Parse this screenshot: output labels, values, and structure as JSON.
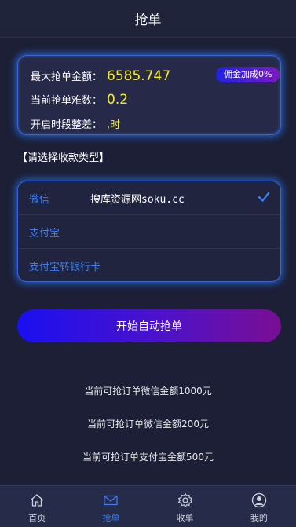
{
  "header": {
    "title": "抢单"
  },
  "stats": {
    "max_amount_label": "最大抢单金额：",
    "max_amount_value": "6585.747",
    "difficulty_label": "当前抢单难数：",
    "difficulty_value": "0.2",
    "period_label": "开启时段整差：",
    "period_value": ",时",
    "badge": "佣金加成0%"
  },
  "section_title": "【请选择收款类型】",
  "payment_options": [
    {
      "label": "微信",
      "note": "搜库资源网soku.cc",
      "selected": true
    },
    {
      "label": "支付宝"
    },
    {
      "label": "支付宝转银行卡"
    }
  ],
  "start_button": "开始自动抢单",
  "info_lines": [
    "当前可抢订单微信金额1000元",
    "当前可抢订单微信金额200元",
    "当前可抢订单支付宝金额500元"
  ],
  "tabs": [
    {
      "label": "首页",
      "icon": "home-icon"
    },
    {
      "label": "抢单",
      "icon": "mail-icon",
      "active": true
    },
    {
      "label": "收单",
      "icon": "gear-icon"
    },
    {
      "label": "我的",
      "icon": "user-icon"
    }
  ],
  "colors": {
    "accent": "#3d7df0",
    "value": "#f7ee2a",
    "background": "#1c1f35"
  }
}
